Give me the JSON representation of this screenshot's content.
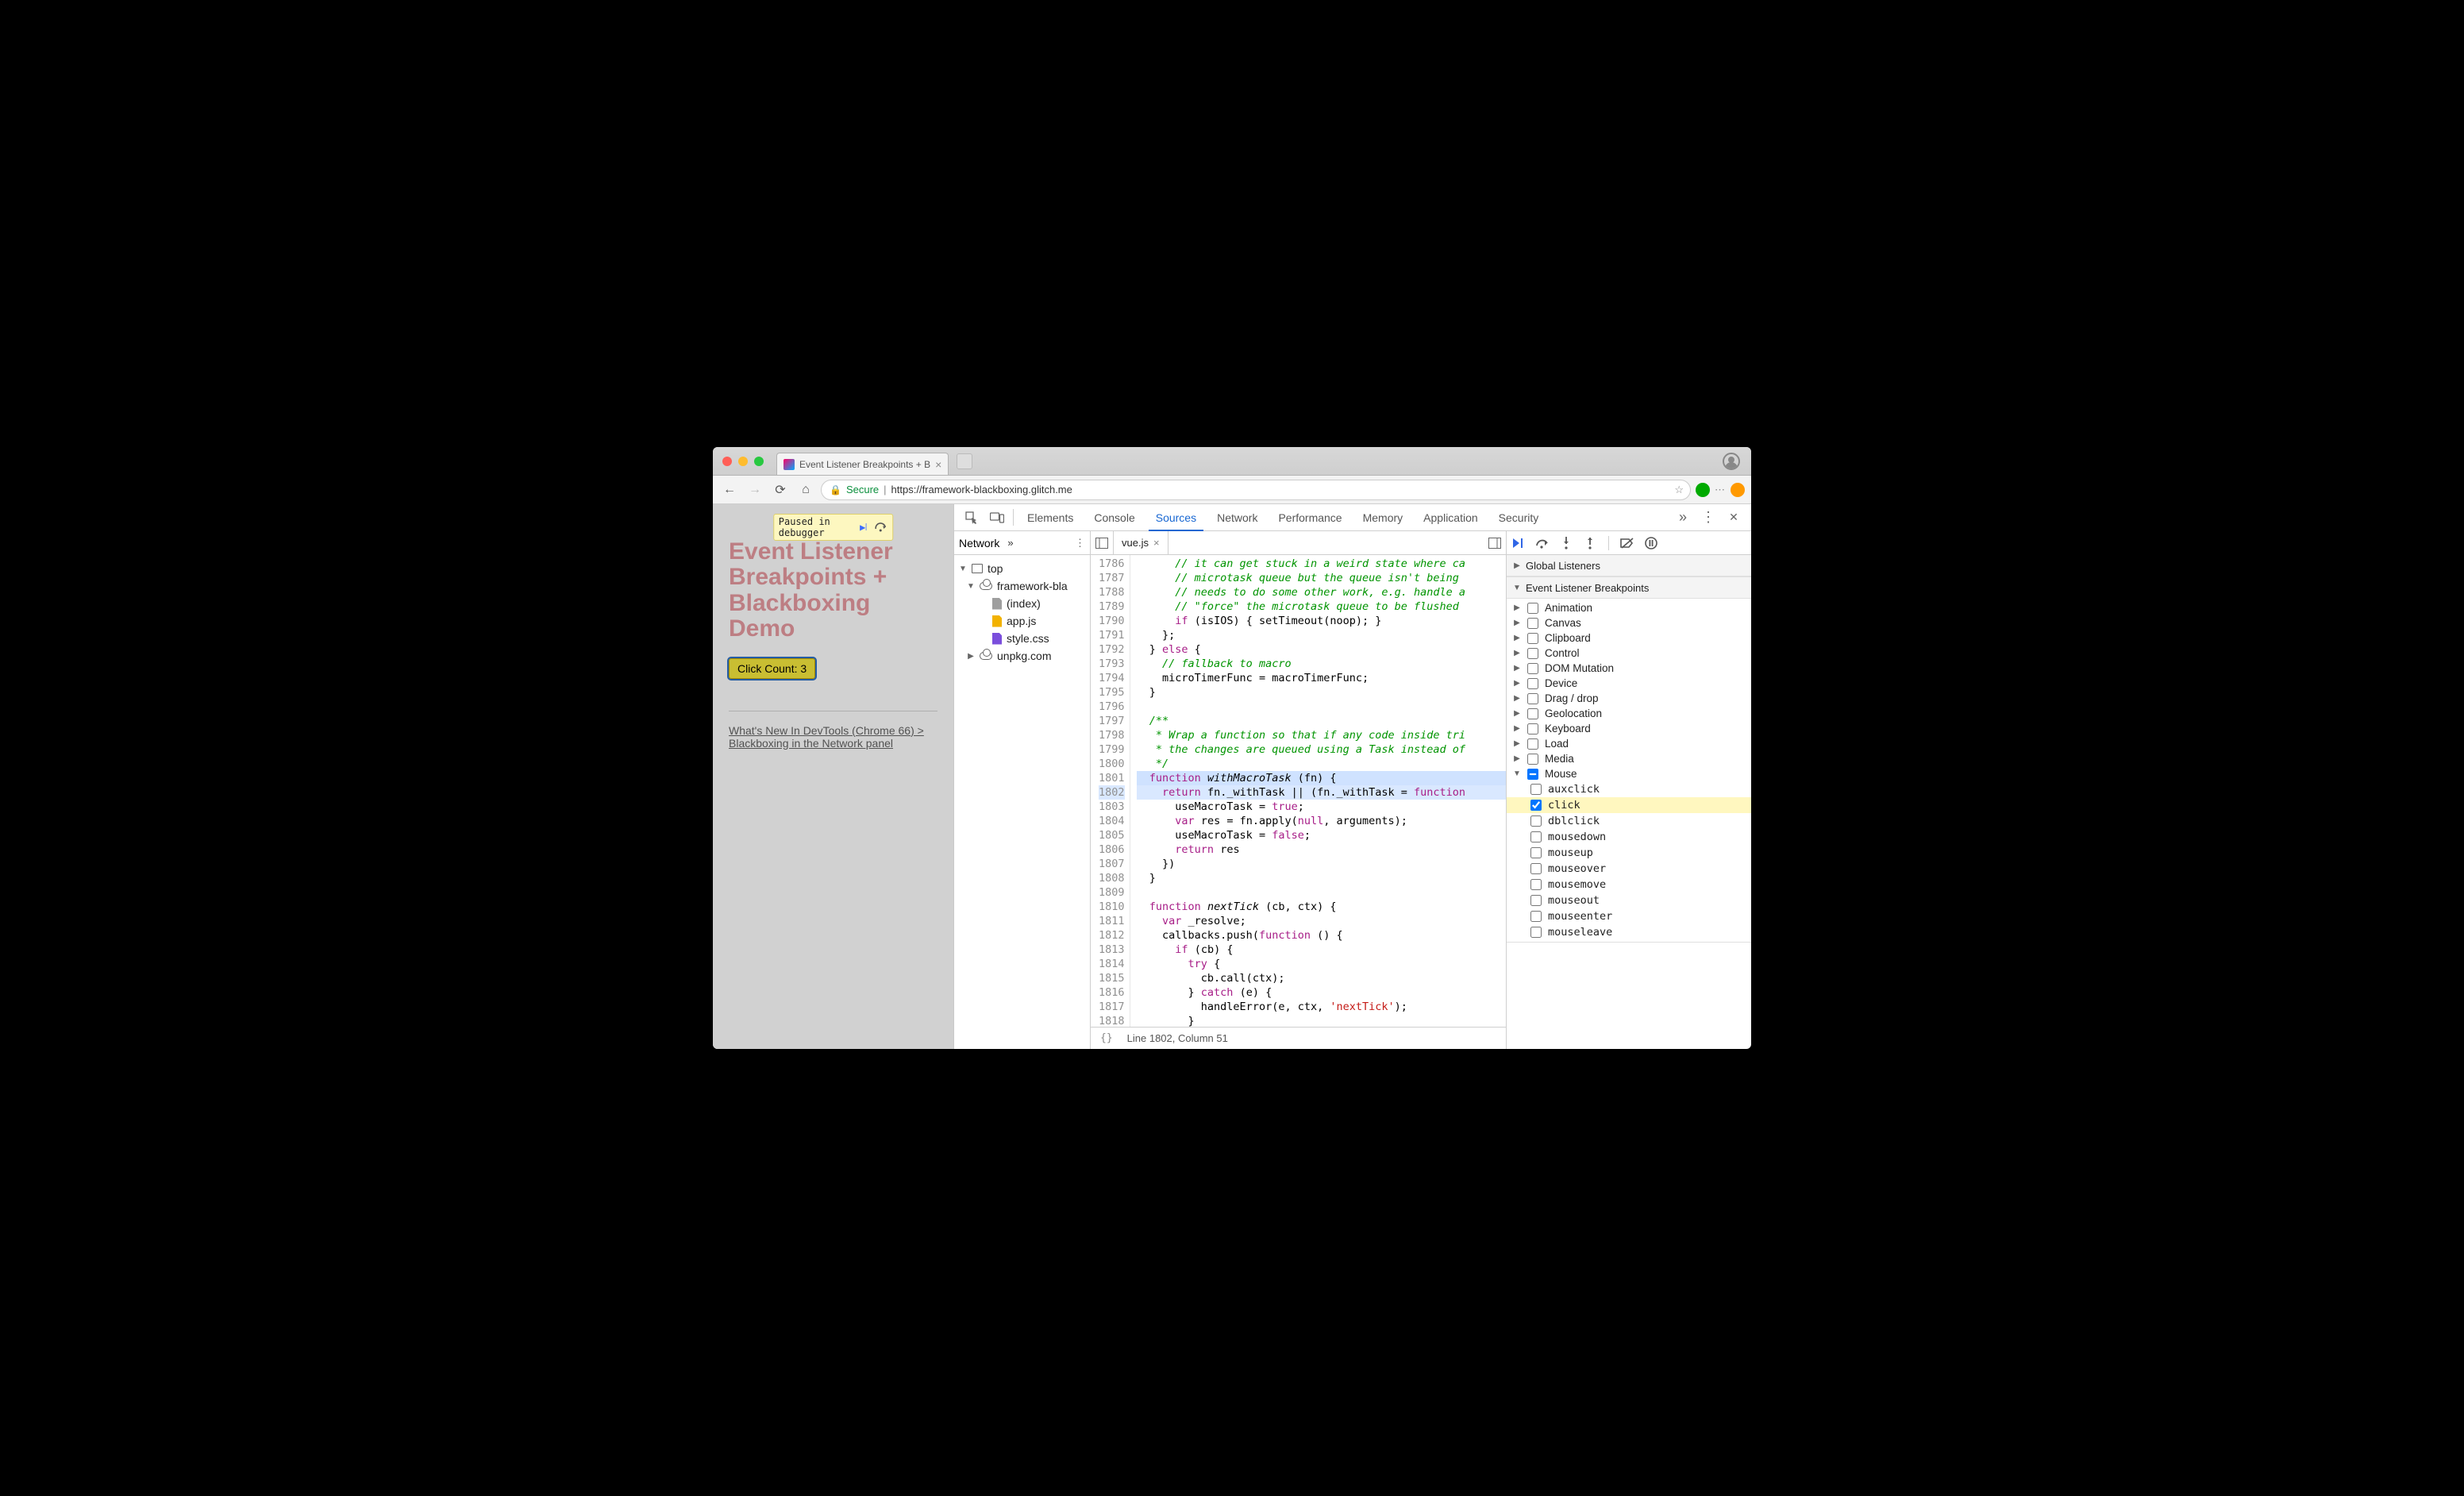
{
  "browser": {
    "tab_title": "Event Listener Breakpoints + B",
    "secure_label": "Secure",
    "url": "https://framework-blackboxing.glitch.me"
  },
  "page": {
    "paused_label": "Paused in debugger",
    "title_html": "Event Listener Breakpoints + Blackboxing Demo",
    "click_button": "Click Count: 3",
    "link_text": "What's New In DevTools (Chrome 66) > Blackboxing in the Network panel"
  },
  "devtools": {
    "tabs": [
      "Elements",
      "Console",
      "Sources",
      "Network",
      "Performance",
      "Memory",
      "Application",
      "Security"
    ],
    "active": 2,
    "sources_nav_label": "Network",
    "tree": {
      "top": "top",
      "domain1": "framework-bla",
      "files": [
        "(index)",
        "app.js",
        "style.css"
      ],
      "domain2": "unpkg.com"
    },
    "editor": {
      "tab": "vue.js",
      "status_line": "Line 1802, Column 51",
      "first_line_no": 1786,
      "lines": [
        {
          "t": "      // it can get stuck in a weird state where ca",
          "cls": "tok-com"
        },
        {
          "t": "      // microtask queue but the queue isn't being ",
          "cls": "tok-com"
        },
        {
          "t": "      // needs to do some other work, e.g. handle a",
          "cls": "tok-com"
        },
        {
          "t": "      // \"force\" the microtask queue to be flushed",
          "cls": "tok-com"
        },
        {
          "raw": "      <span class='tok-kw'>if</span> (isIOS) { setTimeout(noop); }"
        },
        {
          "t": "    };"
        },
        {
          "raw": "  } <span class='tok-kw'>else</span> {"
        },
        {
          "t": "    // fallback to macro",
          "cls": "tok-com"
        },
        {
          "raw": "    microTimerFunc = macroTimerFunc;"
        },
        {
          "t": "  }"
        },
        {
          "t": ""
        },
        {
          "t": "  /**",
          "cls": "tok-com"
        },
        {
          "t": "   * Wrap a function so that if any code inside tri",
          "cls": "tok-com"
        },
        {
          "t": "   * the changes are queued using a Task instead of",
          "cls": "tok-com"
        },
        {
          "t": "   */",
          "cls": "tok-com"
        },
        {
          "raw": "  <span class='tok-kw'>function</span> <span class='tok-fn'>withMacroTask</span> (fn) {",
          "hl": "line"
        },
        {
          "raw": "    <span class='tok-kw'>return</span> fn._withTask || (fn._withTask = <span class='tok-kw'>function</span>",
          "hl": "exec"
        },
        {
          "raw": "      useMacroTask = <span class='tok-kw'>true</span>;"
        },
        {
          "raw": "      <span class='tok-kw'>var</span> res = fn.apply(<span class='tok-kw'>null</span>, arguments);"
        },
        {
          "raw": "      useMacroTask = <span class='tok-kw'>false</span>;"
        },
        {
          "raw": "      <span class='tok-kw'>return</span> res"
        },
        {
          "t": "    })"
        },
        {
          "t": "  }"
        },
        {
          "t": ""
        },
        {
          "raw": "  <span class='tok-kw'>function</span> <span class='tok-fn'>nextTick</span> (cb, ctx) {"
        },
        {
          "raw": "    <span class='tok-kw'>var</span> _resolve;"
        },
        {
          "raw": "    callbacks.push(<span class='tok-kw'>function</span> () {"
        },
        {
          "raw": "      <span class='tok-kw'>if</span> (cb) {"
        },
        {
          "raw": "        <span class='tok-kw'>try</span> {"
        },
        {
          "raw": "          cb.call(ctx);"
        },
        {
          "raw": "        } <span class='tok-kw'>catch</span> (e) {"
        },
        {
          "raw": "          handleError(e, ctx, <span class='tok-str'>'nextTick'</span>);"
        },
        {
          "t": "        }"
        }
      ]
    },
    "debugger": {
      "global_listeners": "Global Listeners",
      "elb": "Event Listener Breakpoints",
      "categories": [
        "Animation",
        "Canvas",
        "Clipboard",
        "Control",
        "DOM Mutation",
        "Device",
        "Drag / drop",
        "Geolocation",
        "Keyboard",
        "Load",
        "Media",
        "Mouse"
      ],
      "mouse_events": [
        "auxclick",
        "click",
        "dblclick",
        "mousedown",
        "mouseup",
        "mouseover",
        "mousemove",
        "mouseout",
        "mouseenter",
        "mouseleave"
      ],
      "checked_event": "click"
    }
  }
}
